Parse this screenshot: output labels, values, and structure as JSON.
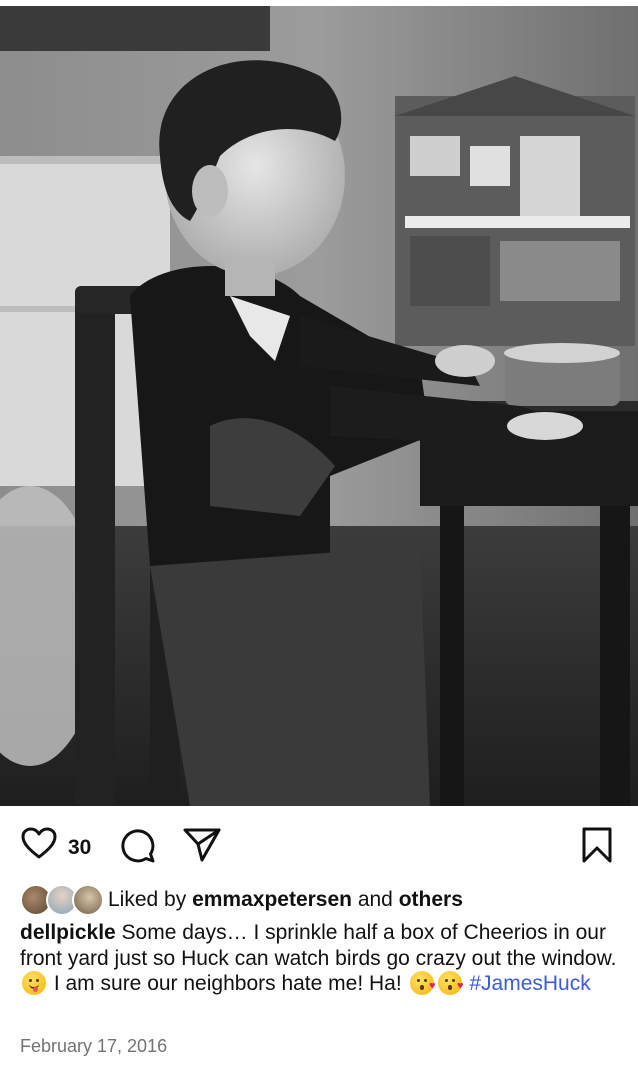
{
  "photo": {
    "description_icon": "photo-image"
  },
  "actions": {
    "like_icon": "heart-outline-icon",
    "like_count": "30",
    "comment_icon": "comment-bubble-icon",
    "share_icon": "paper-plane-icon",
    "save_icon": "bookmark-icon"
  },
  "likes": {
    "prefix": "Liked by",
    "user": "emmaxpetersen",
    "joiner": "and",
    "others": "others"
  },
  "caption": {
    "username": "dellpickle",
    "text_part1": " Some days… I sprinkle half a box of Cheerios in our front yard just so Huck can watch birds go crazy out the window. ",
    "emoji1": "face-savoring-food",
    "text_part2": " I am sure our neighbors hate me! Ha! ",
    "emoji2": "face-blowing-kiss",
    "emoji3": "face-blowing-kiss",
    "hashtag": "#JamesHuck"
  },
  "date": "February 17, 2016",
  "colors": {
    "hashtag": "#3b5bdb",
    "date": "#737373",
    "text": "#111111"
  }
}
